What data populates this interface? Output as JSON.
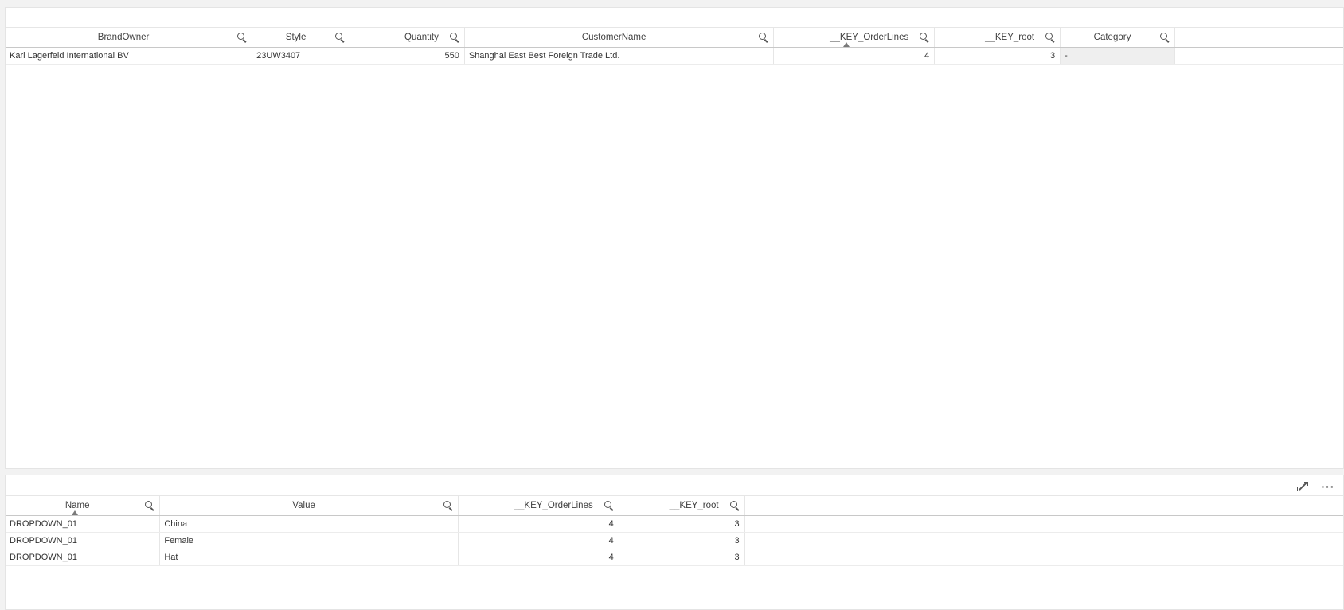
{
  "top_table": {
    "columns": [
      {
        "label": "BrandOwner"
      },
      {
        "label": "Style"
      },
      {
        "label": "Quantity"
      },
      {
        "label": "CustomerName"
      },
      {
        "label": "__KEY_OrderLines"
      },
      {
        "label": "__KEY_root"
      },
      {
        "label": "Category"
      }
    ],
    "rows": [
      [
        "Karl Lagerfeld International BV",
        "23UW3407",
        "550",
        "Shanghai East Best Foreign Trade Ltd.",
        "4",
        "3",
        "-"
      ]
    ]
  },
  "bottom_table": {
    "columns": [
      {
        "label": "Name"
      },
      {
        "label": "Value"
      },
      {
        "label": "__KEY_OrderLines"
      },
      {
        "label": "__KEY_root"
      }
    ],
    "rows": [
      [
        "DROPDOWN_01",
        "China",
        "4",
        "3"
      ],
      [
        "DROPDOWN_01",
        "Female",
        "4",
        "3"
      ],
      [
        "DROPDOWN_01",
        "Hat",
        "4",
        "3"
      ]
    ]
  },
  "toolbar": {
    "expand_icon": "expand-icon",
    "more_label": "···"
  }
}
